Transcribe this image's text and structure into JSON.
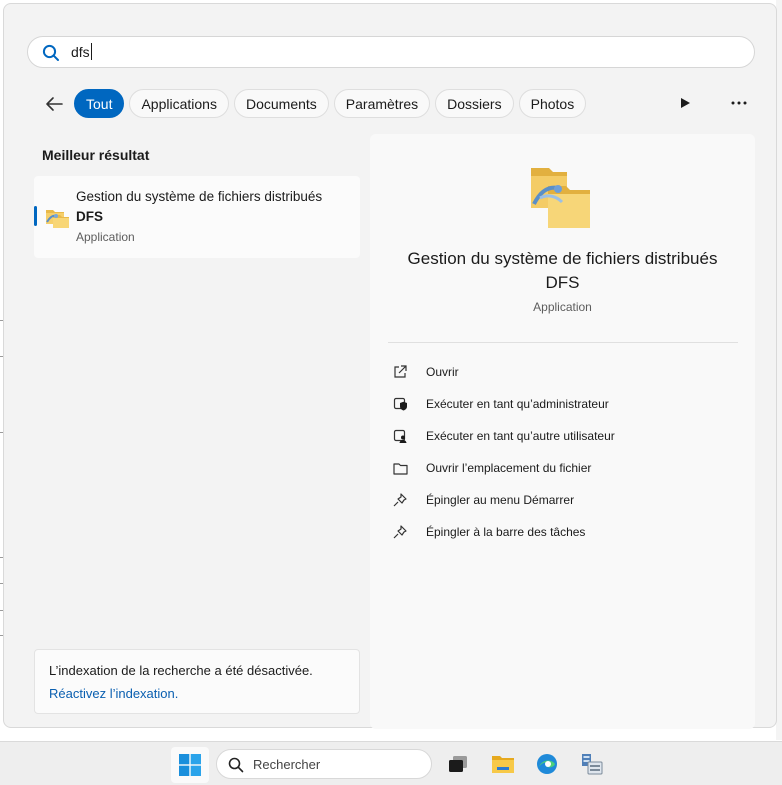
{
  "search": {
    "query": "dfs"
  },
  "filters": {
    "back_label": "",
    "chips": [
      {
        "label": "Tout",
        "active": true
      },
      {
        "label": "Applications",
        "active": false
      },
      {
        "label": "Documents",
        "active": false
      },
      {
        "label": "Paramètres",
        "active": false
      },
      {
        "label": "Dossiers",
        "active": false
      },
      {
        "label": "Photos",
        "active": false
      }
    ]
  },
  "best_match": {
    "heading": "Meilleur résultat",
    "title_line1": "Gestion du système de fichiers distribués",
    "title_line2": "DFS",
    "type": "Application"
  },
  "detail": {
    "title_line1": "Gestion du système de fichiers distribués",
    "title_line2": "DFS",
    "type": "Application",
    "actions": [
      {
        "label": "Ouvrir",
        "icon": "open-external-icon"
      },
      {
        "label": "Exécuter en tant qu’administrateur",
        "icon": "shield-admin-icon"
      },
      {
        "label": "Exécuter en tant qu’autre utilisateur",
        "icon": "user-shield-icon"
      },
      {
        "label": "Ouvrir l’emplacement du fichier",
        "icon": "folder-icon"
      },
      {
        "label": "Épingler au menu Démarrer",
        "icon": "pin-icon"
      },
      {
        "label": "Épingler à la barre des tâches",
        "icon": "pin-icon"
      }
    ]
  },
  "index_notice": {
    "message": "L’indexation de la recherche a été désactivée.",
    "link": "Réactivez l’indexation."
  },
  "taskbar": {
    "search_placeholder": "Rechercher",
    "apps": [
      "task-view-icon",
      "file-explorer-icon",
      "edge-icon",
      "server-manager-icon"
    ]
  },
  "colors": {
    "accent": "#0067c0",
    "link": "#0a5fb0",
    "panel": "#f3f3f3"
  }
}
